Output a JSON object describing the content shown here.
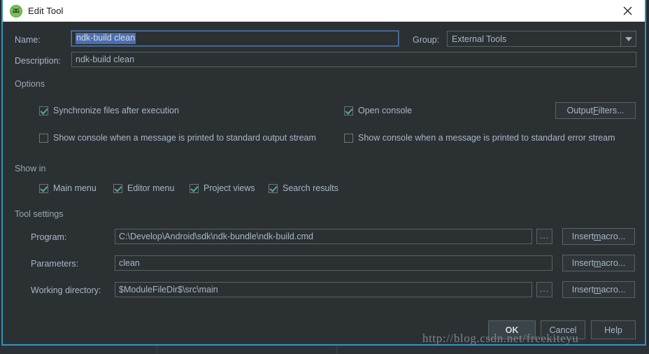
{
  "window": {
    "title": "Edit Tool",
    "app_icon": "android-studio-icon",
    "close_icon": "close-icon",
    "accent_color": "#3592c4",
    "titlebar_bg": "#ffffff",
    "dialog_bg": "#2b3033",
    "text_color": "#a9b7c6",
    "check_color": "#57a89a",
    "selection_color": "#4b6eaf"
  },
  "top": {
    "name_label": "Name:",
    "name_value": "ndk-build clean",
    "group_label": "Group:",
    "group_value": "External Tools",
    "description_label": "Description:",
    "description_value": "ndk-build clean"
  },
  "options": {
    "section_label": "Options",
    "sync_files": {
      "label": "Synchronize files after execution",
      "checked": true
    },
    "open_console": {
      "label": "Open console",
      "checked": true
    },
    "show_console_stdout": {
      "label": "Show console when a message is printed to standard output stream",
      "checked": false
    },
    "show_console_stderr": {
      "label": "Show console when a message is printed to standard error stream",
      "checked": false
    },
    "output_filters_button": {
      "pre": "Output ",
      "mnemonic": "F",
      "post": "ilters..."
    }
  },
  "show_in": {
    "section_label": "Show in",
    "items": [
      {
        "label": "Main menu",
        "checked": true
      },
      {
        "label": "Editor menu",
        "checked": true
      },
      {
        "label": "Project views",
        "checked": true
      },
      {
        "label": "Search results",
        "checked": true
      }
    ]
  },
  "tool_settings": {
    "section_label": "Tool settings",
    "program_label": "Program:",
    "program_value": "C:\\Develop\\Android\\sdk\\ndk-bundle\\ndk-build.cmd",
    "parameters_label": "Parameters:",
    "parameters_value": "clean",
    "working_dir_label": "Working directory:",
    "working_dir_value": "$ModuleFileDir$\\src\\main",
    "browse_label": "...",
    "insert_macro": {
      "pre": "Insert ",
      "mnemonic": "m",
      "post": "acro..."
    }
  },
  "footer": {
    "ok_label": "OK",
    "cancel_label": "Cancel",
    "help_label": "Help"
  },
  "watermark": "http://blog.csdn.net/freekiteyu"
}
